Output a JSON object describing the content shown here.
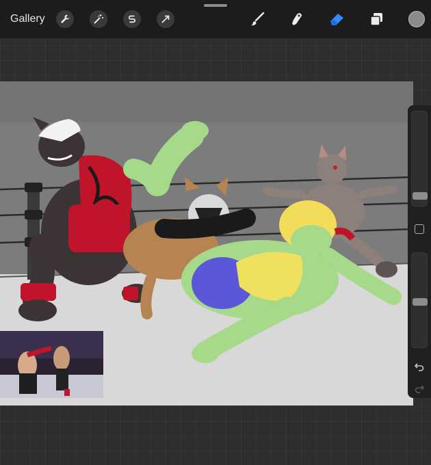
{
  "topbar": {
    "gallery_label": "Gallery",
    "left_tools": [
      "wrench-icon",
      "magic-wand-icon",
      "selection-s-icon",
      "transform-arrow-icon"
    ],
    "right_tools": [
      "brush-icon",
      "smudge-icon",
      "eraser-icon",
      "layers-icon"
    ],
    "active_tool": "eraser-icon",
    "active_color": "#2f8cff",
    "current_color": "#8a8a8a"
  },
  "sidebar": {
    "brush_size_level": 0.35,
    "opacity_level": 0.35,
    "buttons": [
      "modify-button",
      "undo-icon",
      "redo-icon"
    ]
  },
  "canvas": {
    "artwork": "wrestling-illustration",
    "reference_photo": "reference-photo"
  }
}
